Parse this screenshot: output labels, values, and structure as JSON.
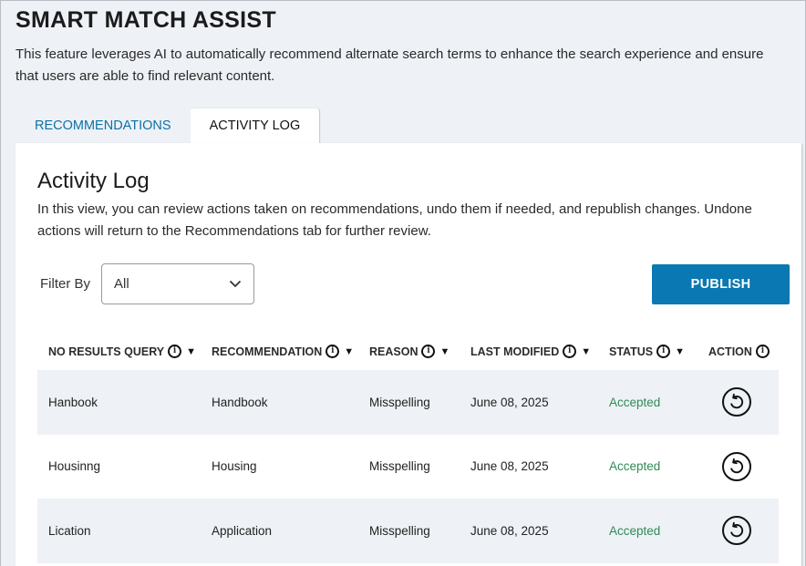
{
  "header": {
    "title": "SMART MATCH ASSIST",
    "description": "This feature leverages AI to automatically recommend alternate search terms to enhance the search experience and ensure that users are able to find relevant content."
  },
  "tabs": [
    {
      "label": "RECOMMENDATIONS",
      "active": false
    },
    {
      "label": "ACTIVITY LOG",
      "active": true
    }
  ],
  "activity_log": {
    "title": "Activity Log",
    "description": "In this view, you can review actions taken on recommendations, undo them if needed, and republish changes. Undone actions will return to the Recommendations tab for further review.",
    "filter": {
      "label": "Filter By",
      "selected": "All"
    },
    "publish_label": "PUBLISH",
    "columns": [
      {
        "label": "NO RESULTS QUERY",
        "info": true,
        "sortable": true
      },
      {
        "label": "RECOMMENDATION",
        "info": true,
        "sortable": true
      },
      {
        "label": "REASON",
        "info": true,
        "sortable": true
      },
      {
        "label": "LAST MODIFIED",
        "info": true,
        "sortable": true
      },
      {
        "label": "STATUS",
        "info": true,
        "sortable": true
      },
      {
        "label": "ACTION",
        "info": true,
        "sortable": false
      }
    ],
    "rows": [
      {
        "query": "Hanbook",
        "recommendation": "Handbook",
        "reason": "Misspelling",
        "modified": "June 08, 2025",
        "status": "Accepted"
      },
      {
        "query": "Housinng",
        "recommendation": "Housing",
        "reason": "Misspelling",
        "modified": "June 08, 2025",
        "status": "Accepted"
      },
      {
        "query": "Lication",
        "recommendation": "Application",
        "reason": "Misspelling",
        "modified": "June 08, 2025",
        "status": "Accepted"
      }
    ]
  },
  "colors": {
    "accent": "#0a78b2",
    "status_accepted": "#2e8b57",
    "row_alt": "#eef1f6"
  },
  "icons": {
    "info": "info-icon",
    "sort": "sort-down-icon",
    "undo": "undo-icon",
    "dropdown": "chevron-down-icon"
  }
}
